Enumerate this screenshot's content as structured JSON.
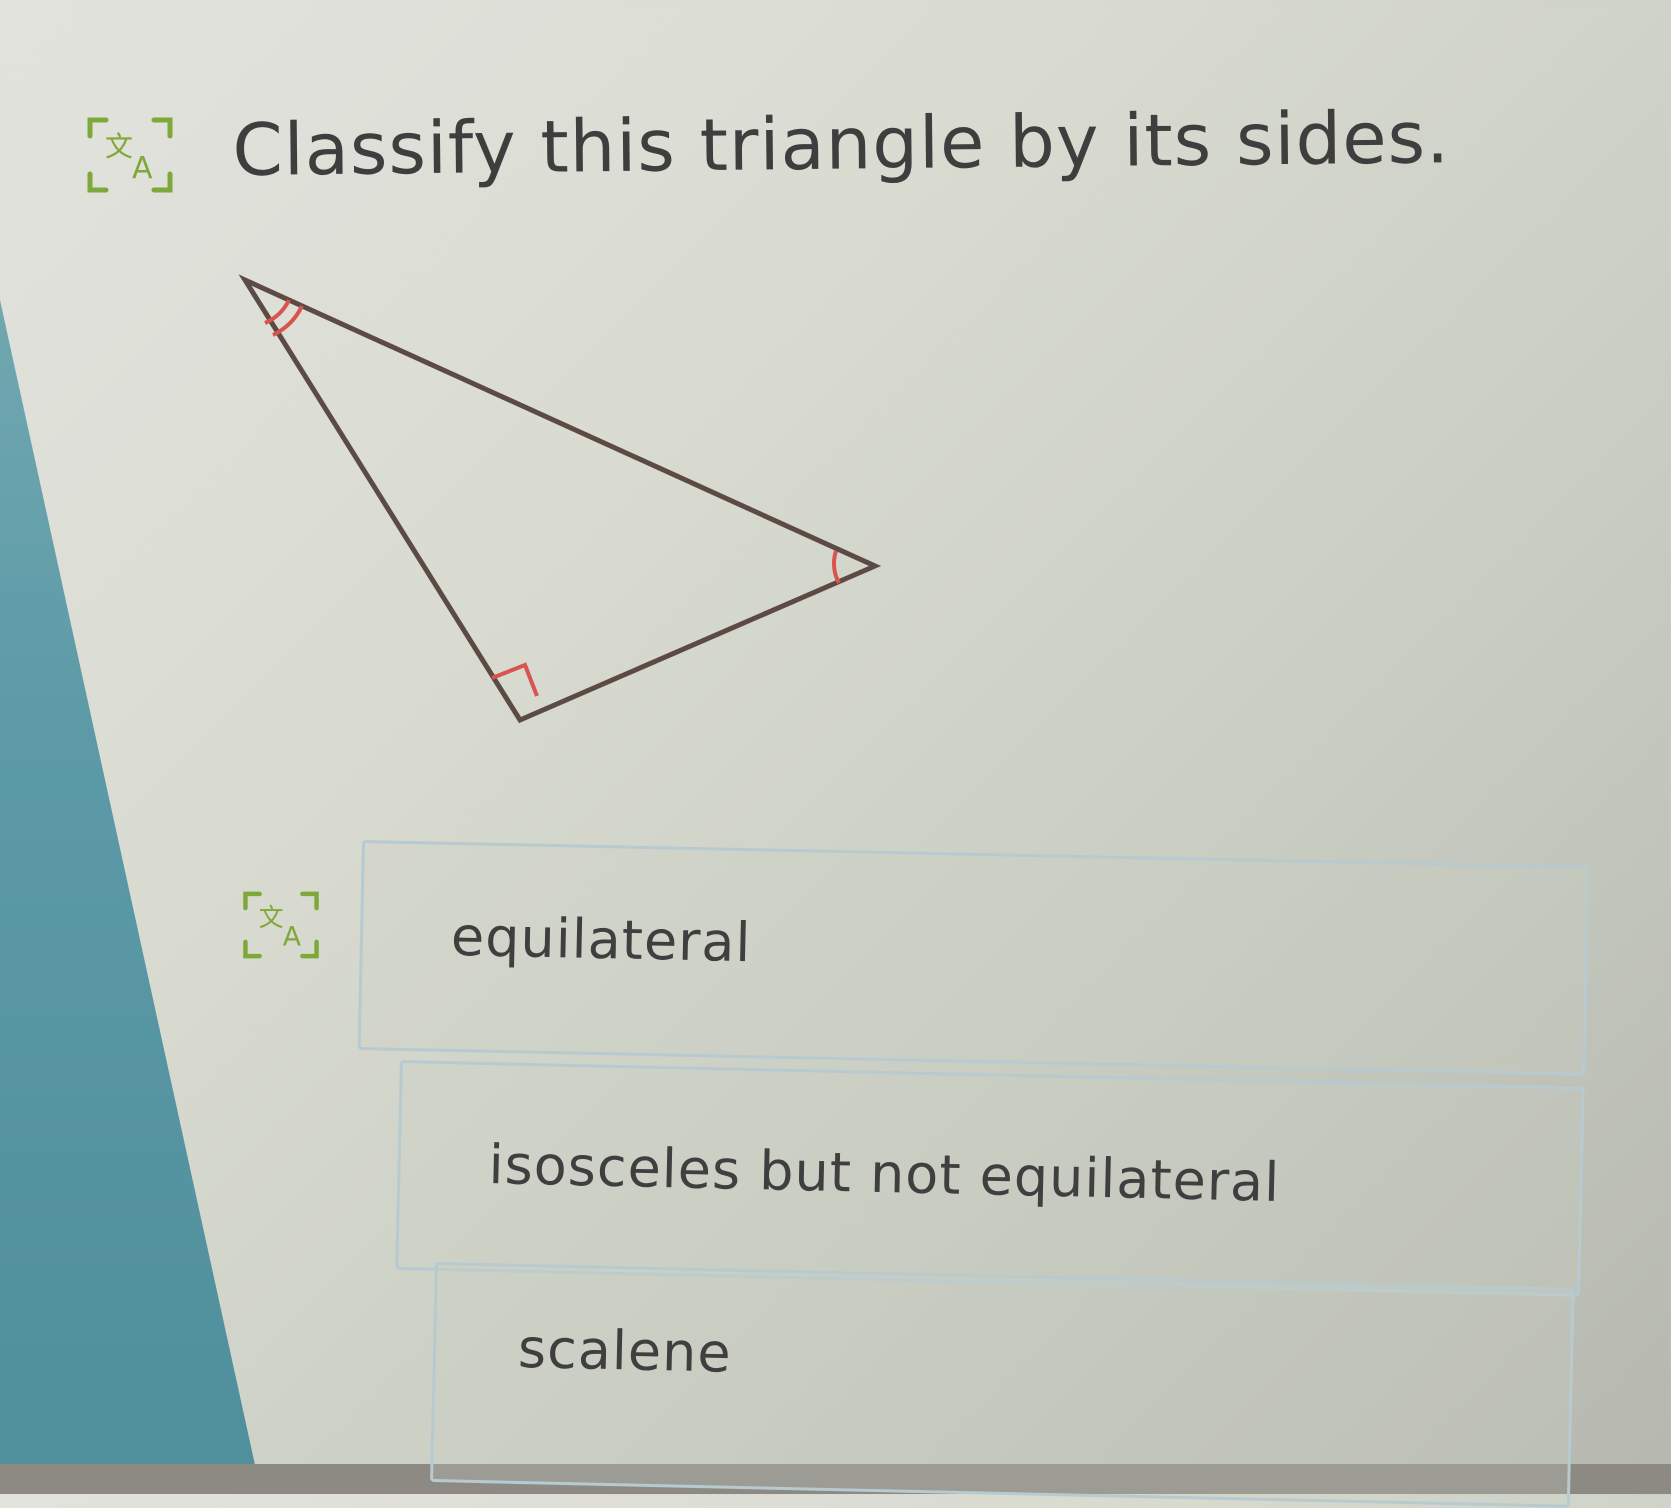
{
  "question": {
    "icon": "translate-icon",
    "text": "Classify this triangle by its sides."
  },
  "figure": {
    "shape": "right triangle",
    "angle_marks": [
      "double-arc",
      "single-arc",
      "right-angle"
    ],
    "line_color": "#5b4b44",
    "mark_color": "#d9534f"
  },
  "answer_options": {
    "icon": "translate-icon",
    "items": [
      {
        "label": "equilateral"
      },
      {
        "label": "isosceles but not equilateral"
      },
      {
        "label": "scalene"
      }
    ]
  },
  "colors": {
    "icon_green": "#7fa83a",
    "accent_teal": "#5b9aa6",
    "option_border": "#b7cad0"
  }
}
